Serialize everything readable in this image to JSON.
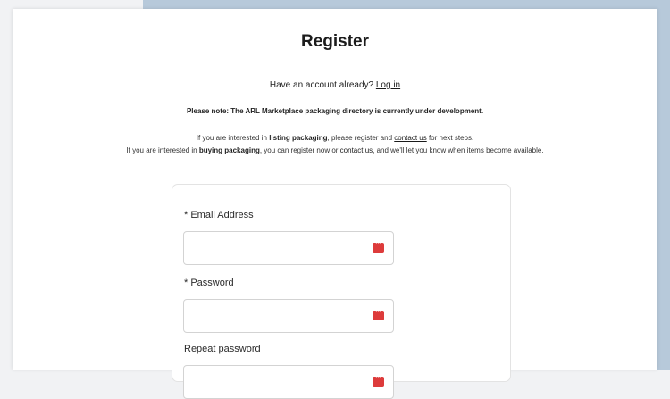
{
  "header": {
    "title": "Register",
    "account_prompt": "Have an account already?",
    "login_link": "Log in"
  },
  "notice": "Please note: The ARL Marketplace packaging directory is currently under development.",
  "info": {
    "line1": {
      "prefix": "If you are interested in ",
      "bold": "listing packaging",
      "middle": ", please register and ",
      "link": "contact us",
      "suffix": " for next steps."
    },
    "line2": {
      "prefix": "If you are interested in ",
      "bold": "buying packaging",
      "middle": ", you can register now or ",
      "link": "contact us",
      "suffix": ", and we'll let you know when items become available."
    }
  },
  "form": {
    "email_label": "* Email Address",
    "email_value": "",
    "password_label": "* Password",
    "password_value": "",
    "repeat_label": "Repeat password",
    "repeat_value": ""
  },
  "icons": {
    "password_manager_icon": "password-manager-icon"
  },
  "colors": {
    "accent_band": "#b7c9da",
    "password_icon": "#dd3b3b"
  }
}
